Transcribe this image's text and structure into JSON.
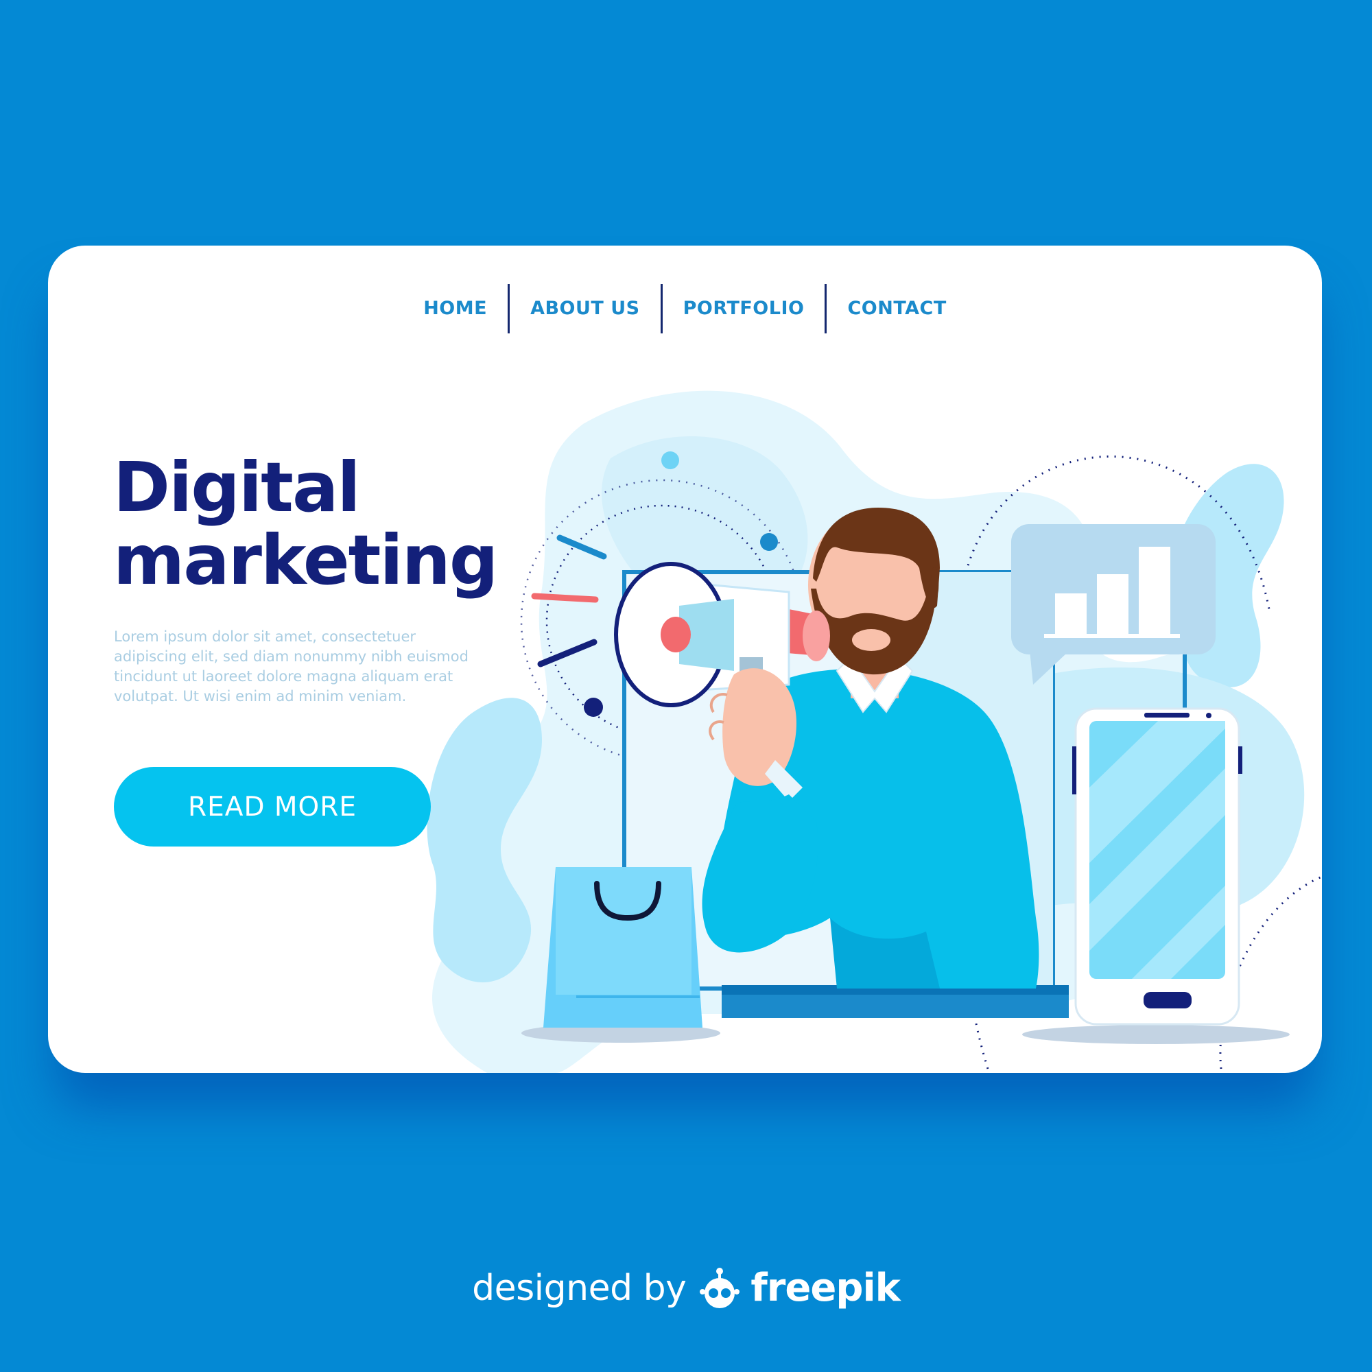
{
  "nav": {
    "items": [
      {
        "label": "HOME"
      },
      {
        "label": "ABOUT US"
      },
      {
        "label": "PORTFOLIO"
      },
      {
        "label": "CONTACT"
      }
    ]
  },
  "hero": {
    "title_line1": "Digital",
    "title_line2": "marketing",
    "body": "Lorem ipsum dolor sit amet, consectetuer adipiscing elit, sed diam nonummy nibh euismod tincidunt ut laoreet dolore magna aliquam erat volutpat. Ut wisi enim ad minim veniam.",
    "button_label": "READ MORE"
  },
  "illustration": {
    "icons": [
      "megaphone-icon",
      "bar-chart-icon",
      "smartphone-icon",
      "shopping-bag-icon",
      "monitor-icon",
      "marketer-figure"
    ]
  },
  "credit": {
    "prefix": "designed by",
    "brand": "freepik"
  },
  "colors": {
    "page_background": "#0489D4",
    "title": "#13207A",
    "nav_text": "#1B8ACB",
    "button": "#05C3EF"
  }
}
